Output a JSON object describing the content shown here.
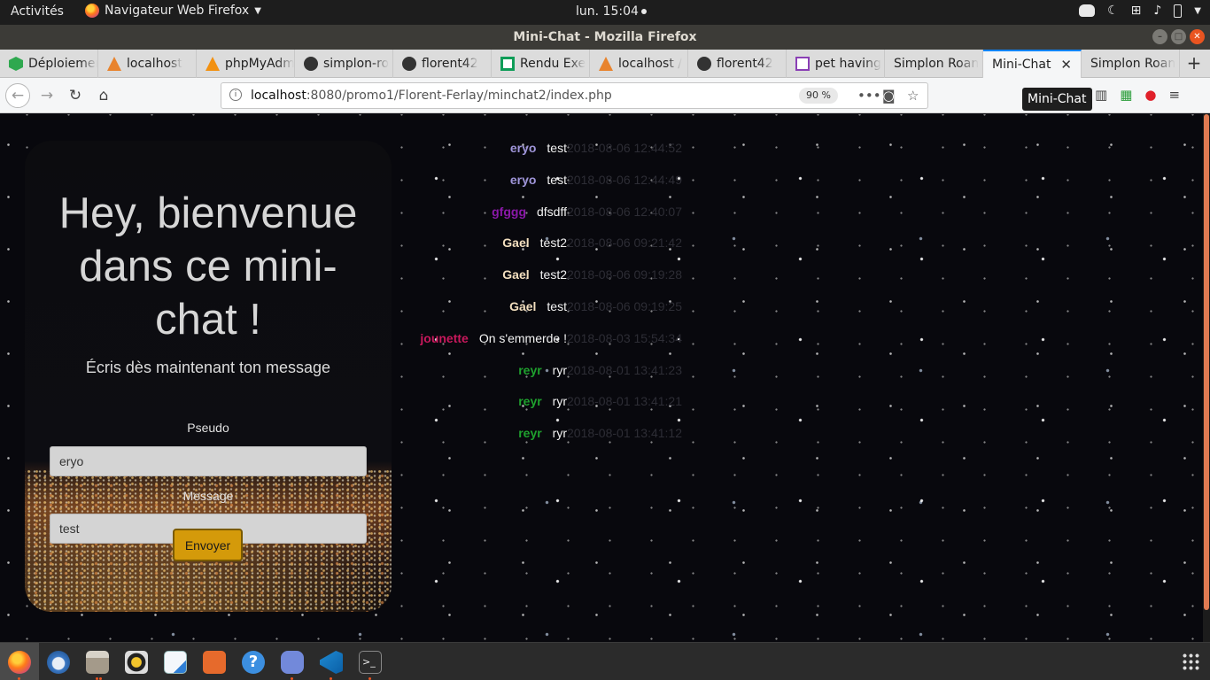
{
  "topbar": {
    "activities": "Activités",
    "app_menu": "Navigateur Web Firefox",
    "clock": "lun. 15:04",
    "tray_icons": [
      "discord-icon",
      "night-light-icon",
      "network-icon",
      "volume-icon",
      "battery-icon",
      "power-menu-icon"
    ]
  },
  "window": {
    "title": "Mini-Chat - Mozilla Firefox"
  },
  "tabs": [
    {
      "label": "Déploiement",
      "icon": "bolt-icon"
    },
    {
      "label": "localhost",
      "icon": "localhost-icon"
    },
    {
      "label": "phpMyAdmin",
      "icon": "phpmyadmin-icon"
    },
    {
      "label": "simplon-ro",
      "icon": "github-icon"
    },
    {
      "label": "florent42",
      "icon": "github-icon"
    },
    {
      "label": "Rendu Exe",
      "icon": "sheet-icon"
    },
    {
      "label": "localhost /",
      "icon": "localhost-icon"
    },
    {
      "label": "florent42",
      "icon": "github-icon"
    },
    {
      "label": "pet having",
      "icon": "pet-icon"
    },
    {
      "label": "Simplon Roan",
      "icon": ""
    },
    {
      "label": "Mini-Chat",
      "icon": "",
      "active": true
    },
    {
      "label": "Simplon Roan",
      "icon": ""
    }
  ],
  "navbar": {
    "url_host": "localhost",
    "url_rest": ":8080/promo1/Florent-Ferlay/minchat2/index.php",
    "zoom": "90 %",
    "tooltip": "Mini-Chat"
  },
  "form": {
    "title": "Hey, bienvenue dans ce mini-chat !",
    "subtitle": "Écris dès maintenant ton message",
    "pseudo_label": "Pseudo",
    "pseudo_value": "eryo",
    "message_label": "Message",
    "message_value": "test",
    "send_label": "Envoyer"
  },
  "colors": {
    "accent_tab": "#0a84ff",
    "send_button": "#d49a0a",
    "scroll_thumb": "#e07a52"
  },
  "messages": [
    {
      "nick": "eryo",
      "text": "test",
      "time": "2018-08-06 12:44:52",
      "color": "#9f95d9"
    },
    {
      "nick": "eryo",
      "text": "test",
      "time": "2018-08-06 12:44:49",
      "color": "#9f95d9"
    },
    {
      "nick": "gfggg",
      "text": "dfsdff",
      "time": "2018-08-06 12:40:07",
      "color": "#8a18a8"
    },
    {
      "nick": "Gael",
      "text": "test2",
      "time": "2018-08-06 09:21:42",
      "color": "#f3dfbf"
    },
    {
      "nick": "Gael",
      "text": "test2",
      "time": "2018-08-06 09:19:28",
      "color": "#f3dfbf"
    },
    {
      "nick": "Gael",
      "text": "test",
      "time": "2018-08-06 09:19:25",
      "color": "#f3dfbf"
    },
    {
      "nick": "jounette",
      "text": "On s'emmerde !",
      "time": "2018-08-03 15:54:34",
      "color": "#c8185c"
    },
    {
      "nick": "reyr",
      "text": "ryr",
      "time": "2018-08-01 13:41:23",
      "color": "#1fa12e"
    },
    {
      "nick": "reyr",
      "text": "ryr",
      "time": "2018-08-01 13:41:21",
      "color": "#1fa12e"
    },
    {
      "nick": "reyr",
      "text": "ryr",
      "time": "2018-08-01 13:41:12",
      "color": "#1fa12e"
    }
  ],
  "dock": [
    "firefox-icon",
    "thunderbird-icon",
    "files-icon",
    "rhythmbox-icon",
    "libreoffice-writer-icon",
    "software-center-icon",
    "help-icon",
    "discord-icon",
    "vscode-icon",
    "terminal-icon"
  ]
}
